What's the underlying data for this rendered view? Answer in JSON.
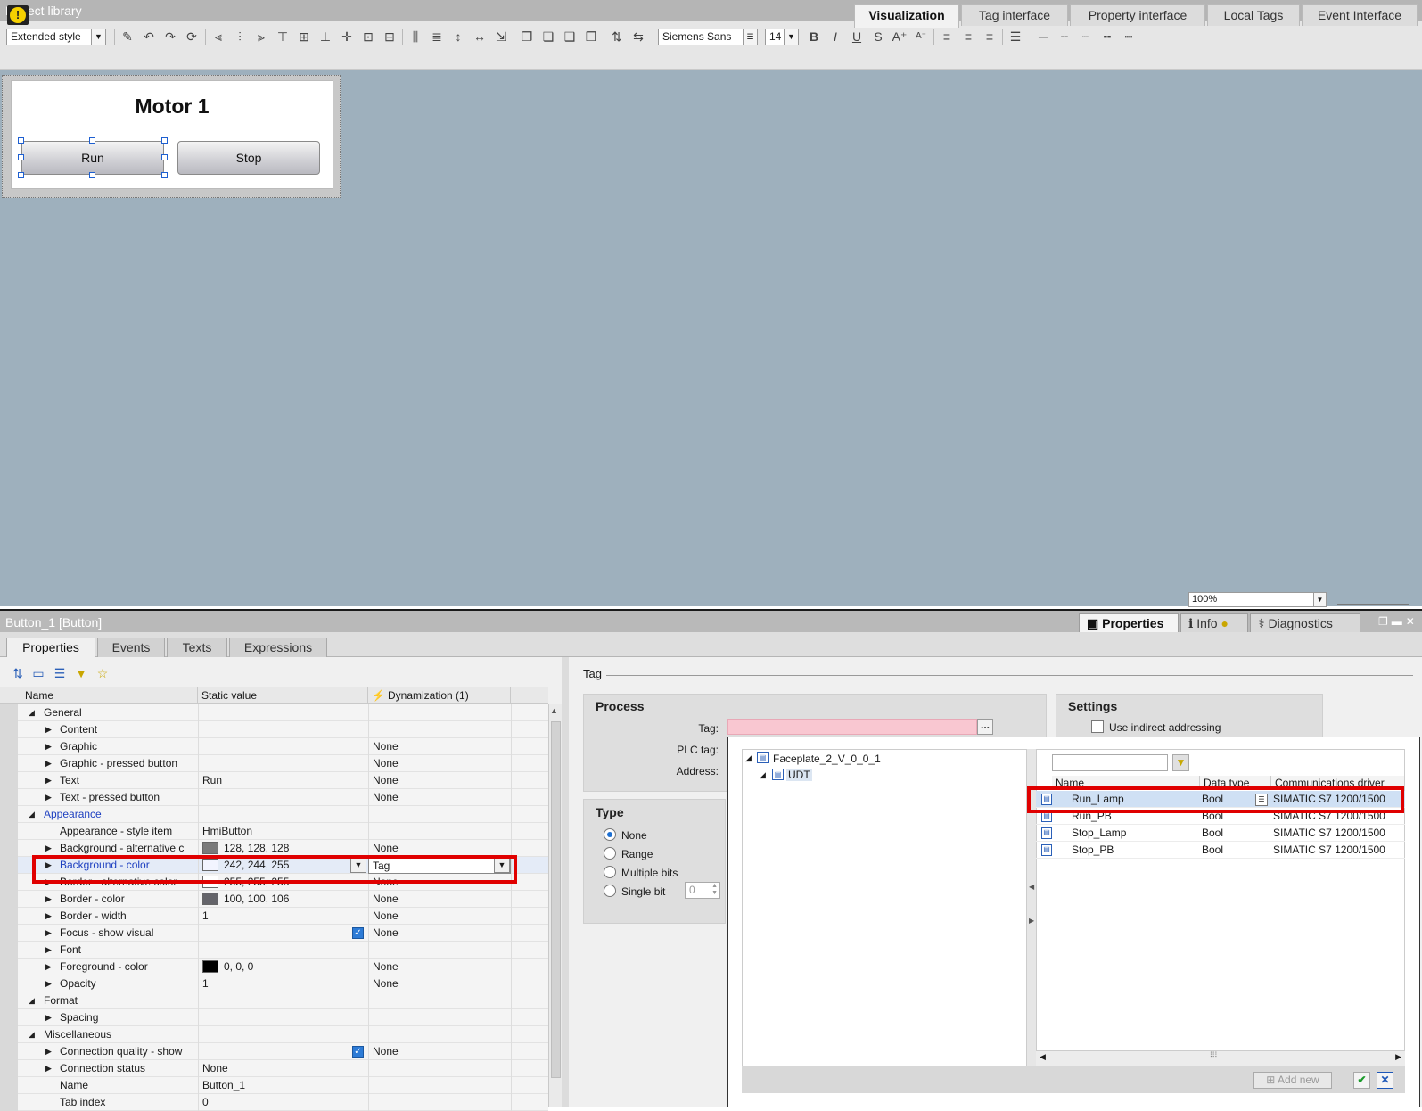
{
  "window": {
    "title": "Project library"
  },
  "editor_tabs": [
    "Visualization",
    "Tag interface",
    "Property interface",
    "Local Tags",
    "Event Interface"
  ],
  "toolbar": {
    "style_combo": "Extended style",
    "font_combo": "Siemens Sans",
    "font_size": "14"
  },
  "faceplate": {
    "title": "Motor 1",
    "run_button": "Run",
    "stop_button": "Stop"
  },
  "zoom": {
    "value": "100%"
  },
  "properties_window": {
    "title": "Button_1 [Button]",
    "top_tabs": [
      "Properties",
      "Info",
      "Diagnostics"
    ],
    "inner_tabs": [
      "Properties",
      "Events",
      "Texts",
      "Expressions"
    ]
  },
  "grid": {
    "headers": [
      "Name",
      "Static value",
      "Dynamization (1)"
    ],
    "rows": [
      {
        "level": 0,
        "name": "General",
        "static": "",
        "dyn": ""
      },
      {
        "level": 1,
        "name": "Content",
        "static": "",
        "dyn": ""
      },
      {
        "level": 1,
        "name": "Graphic",
        "static": "",
        "dyn": "None"
      },
      {
        "level": 1,
        "name": "Graphic - pressed button",
        "static": "",
        "dyn": "None"
      },
      {
        "level": 1,
        "name": "Text",
        "static": "Run",
        "dyn": "None"
      },
      {
        "level": 1,
        "name": "Text - pressed button",
        "static": "",
        "dyn": "None"
      },
      {
        "level": 0,
        "name": "Appearance",
        "static": "",
        "dyn": ""
      },
      {
        "level": 2,
        "name": "Appearance - style item",
        "static": "HmiButton",
        "dyn": ""
      },
      {
        "level": 1,
        "name": "Background - alternative c",
        "static": "128, 128, 128",
        "dyn": "None",
        "swatch": "#7a7a7a"
      },
      {
        "level": 1,
        "name": "Background - color",
        "static": "242, 244, 255",
        "dyn": "Tag",
        "swatch": "#f2f4ff"
      },
      {
        "level": 1,
        "name": "Border - alternative color",
        "static": "255, 255, 255",
        "dyn": "None",
        "swatch": "#ffffff"
      },
      {
        "level": 1,
        "name": "Border - color",
        "static": "100, 100, 106",
        "dyn": "None",
        "swatch": "#64646a"
      },
      {
        "level": 1,
        "name": "Border - width",
        "static": "1",
        "dyn": "None"
      },
      {
        "level": 1,
        "name": "Focus - show visual",
        "static": "",
        "dyn": "None",
        "check": true
      },
      {
        "level": 1,
        "name": "Font",
        "static": "",
        "dyn": ""
      },
      {
        "level": 1,
        "name": "Foreground - color",
        "static": "0, 0, 0",
        "dyn": "None",
        "swatch": "#000000"
      },
      {
        "level": 1,
        "name": "Opacity",
        "static": "1",
        "dyn": "None"
      },
      {
        "level": 0,
        "name": "Format",
        "static": "",
        "dyn": ""
      },
      {
        "level": 1,
        "name": "Spacing",
        "static": "",
        "dyn": ""
      },
      {
        "level": 0,
        "name": "Miscellaneous",
        "static": "",
        "dyn": ""
      },
      {
        "level": 1,
        "name": "Connection quality - show",
        "static": "",
        "dyn": "None",
        "check": true
      },
      {
        "level": 1,
        "name": "Connection status",
        "static": "None",
        "dyn": ""
      },
      {
        "level": 2,
        "name": "Name",
        "static": "Button_1",
        "dyn": ""
      },
      {
        "level": 2,
        "name": "Tab index",
        "static": "0",
        "dyn": ""
      }
    ]
  },
  "tag_panel": {
    "caption": "Tag",
    "process": {
      "title": "Process",
      "tag_label": "Tag:",
      "plc_tag_label": "PLC tag:",
      "address_label": "Address:"
    },
    "settings": {
      "title": "Settings",
      "indirect_label": "Use indirect addressing"
    },
    "type": {
      "title": "Type",
      "options": [
        "None",
        "Range",
        "Multiple bits",
        "Single bit"
      ],
      "selected": "None",
      "single_bit_value": "0"
    }
  },
  "tag_popup": {
    "tree": [
      {
        "label": "Faceplate_2_V_0_0_1"
      },
      {
        "label": "UDT"
      }
    ],
    "columns": [
      "Name",
      "Data type",
      "Communications driver"
    ],
    "rows": [
      {
        "name": "Run_Lamp",
        "type": "Bool",
        "driver": "SIMATIC S7 1200/1500"
      },
      {
        "name": "Run_PB",
        "type": "Bool",
        "driver": "SIMATIC S7 1200/1500"
      },
      {
        "name": "Stop_Lamp",
        "type": "Bool",
        "driver": "SIMATIC S7 1200/1500"
      },
      {
        "name": "Stop_PB",
        "type": "Bool",
        "driver": "SIMATIC S7 1200/1500"
      }
    ],
    "add_new": "Add new"
  },
  "colors": {
    "highlight": "#e00000",
    "canvas": "#9eb0bd",
    "tag_invalid": "#f9c7d1"
  }
}
